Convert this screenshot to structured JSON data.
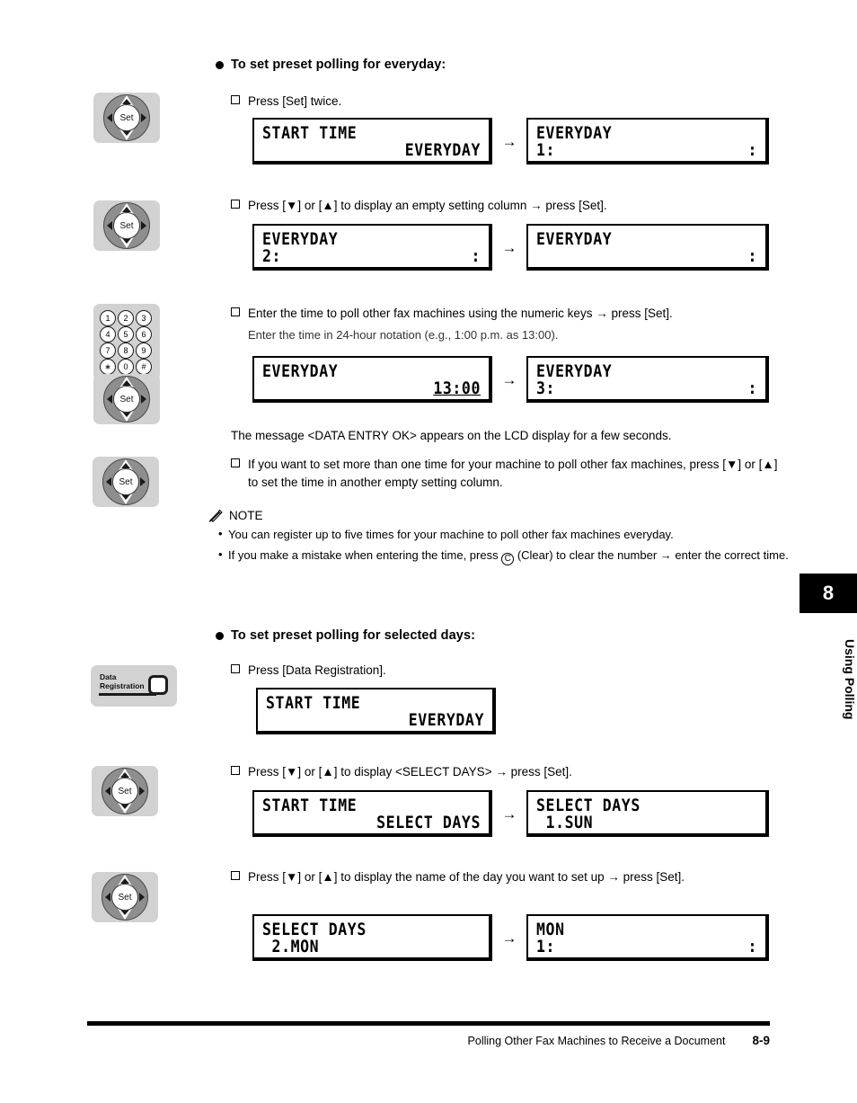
{
  "page": {
    "chapter_number": "8",
    "chapter_label": "Using Polling",
    "footer_title": "Polling Other Fax Machines to Receive a Document",
    "page_number": "8-9"
  },
  "sections": [
    {
      "heading": "To set preset polling for everyday:",
      "steps": [
        {
          "text": "Press [Set] twice."
        },
        {
          "text": "Press [▼] or [▲] to display an empty setting column → press [Set]."
        },
        {
          "text": "Enter the time to poll other fax machines using the numeric keys → press [Set]."
        },
        {
          "text": "If you want to set more than one time for your machine to poll other fax machines, press [▼] or [▲] to set the time in another empty setting column."
        }
      ],
      "subnote": "Enter the time in 24-hour notation (e.g., 1:00 p.m. as 13:00).",
      "paragraph": "The message <DATA ENTRY OK> appears on the LCD display for a few seconds."
    },
    {
      "heading": "To set preset polling for selected days:",
      "steps": [
        {
          "text": "Press [Data Registration]."
        },
        {
          "text": "Press [▼] or [▲] to display <SELECT DAYS> → press [Set]."
        },
        {
          "text": "Press [▼] or [▲] to display the name of the day you want to set up → press [Set]."
        }
      ]
    }
  ],
  "note": {
    "label": "NOTE",
    "icon": "pencil-icon",
    "items": [
      {
        "pre": "You can register up to five times for your machine to poll other fax machines everyday.",
        "circle": "",
        "post": ""
      },
      {
        "pre": "If you make a mistake when entering the time, press ",
        "circle": "C",
        "post": " (Clear) to clear the number → enter the correct time."
      }
    ]
  },
  "lcd_pairs": [
    {
      "id": "lcd-pair-1",
      "arrow": "→",
      "left": {
        "l1": "START TIME",
        "l2": "",
        "r1": "",
        "r2": "EVERYDAY",
        "underline": false
      },
      "right": {
        "l1": "EVERYDAY",
        "l2": "1:",
        "r1": "",
        "r2": ":",
        "underline": false
      }
    },
    {
      "id": "lcd-pair-2",
      "arrow": "→",
      "left": {
        "l1": "EVERYDAY",
        "l2": "2:",
        "r1": "",
        "r2": ":",
        "underline": false
      },
      "right": {
        "l1": "EVERYDAY",
        "l2": "",
        "r1": "",
        "r2": ":",
        "underline": false
      }
    },
    {
      "id": "lcd-pair-3",
      "arrow": "→",
      "left": {
        "l1": "EVERYDAY",
        "l2": "",
        "r1": "",
        "r2": "13:00",
        "underline": true
      },
      "right": {
        "l1": "EVERYDAY",
        "l2": "3:",
        "r1": "",
        "r2": ":",
        "underline": false
      }
    },
    {
      "id": "lcd-pair-4",
      "arrow": "",
      "left": {
        "l1": "START TIME",
        "l2": "",
        "r1": "",
        "r2": "EVERYDAY",
        "underline": false
      },
      "right": null
    },
    {
      "id": "lcd-pair-5",
      "arrow": "→",
      "left": {
        "l1": "START TIME",
        "l2": "",
        "r1": "",
        "r2": "SELECT DAYS",
        "underline": false
      },
      "right": {
        "l1": "SELECT DAYS",
        "l2": " 1.SUN",
        "r1": "",
        "r2": "",
        "underline": false
      }
    },
    {
      "id": "lcd-pair-6",
      "arrow": "→",
      "left": {
        "l1": "SELECT DAYS",
        "l2": " 2.MON",
        "r1": "",
        "r2": "",
        "underline": false
      },
      "right": {
        "l1": "MON",
        "l2": "1:",
        "r1": "",
        "r2": ":",
        "underline": false
      }
    }
  ],
  "keys": {
    "set_label": "Set",
    "data_registration_line1": "Data",
    "data_registration_line2": "Registration",
    "keypad": [
      "1",
      "2",
      "3",
      "4",
      "5",
      "6",
      "7",
      "8",
      "9",
      "∗",
      "0",
      "#"
    ]
  }
}
